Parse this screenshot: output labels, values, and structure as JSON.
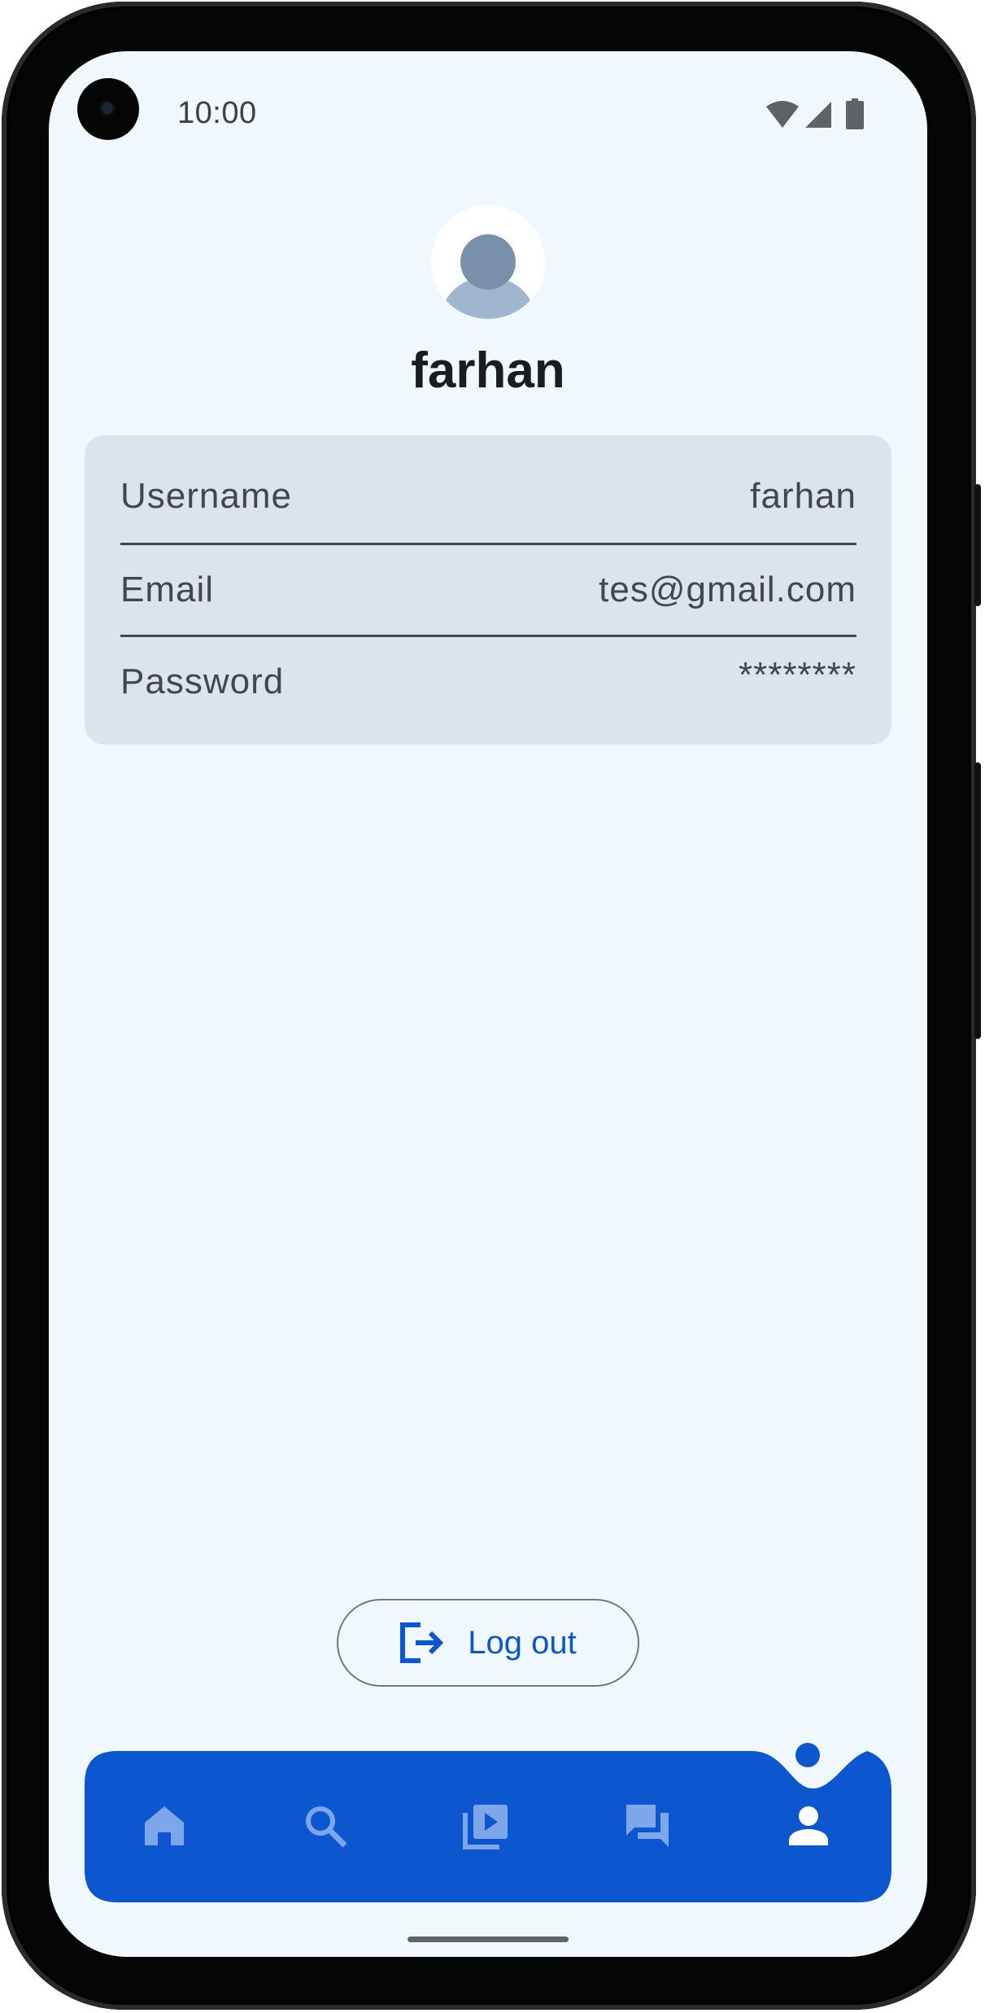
{
  "status_bar": {
    "time": "10:00",
    "icons": [
      "wifi-icon",
      "cell-signal-icon",
      "battery-icon"
    ]
  },
  "profile": {
    "name": "farhan",
    "avatar_icon": "person-avatar-icon"
  },
  "account_info": {
    "rows": [
      {
        "label": "Username",
        "value": "farhan"
      },
      {
        "label": "Email",
        "value": "tes@gmail.com"
      },
      {
        "label": "Password",
        "value": "********"
      }
    ]
  },
  "logout": {
    "label": "Log out",
    "icon": "logout-icon"
  },
  "bottom_nav": {
    "items": [
      "home-icon",
      "search-icon",
      "video-library-icon",
      "chat-icon",
      "person-icon"
    ],
    "selected": "person-icon"
  },
  "colors": {
    "accent": "#0c57d0",
    "screen_background": "#f0f8fd",
    "card_background": "#dde3ea",
    "nav_icon_inactive": "#7ea6eb",
    "nav_icon_active": "#ffffff"
  }
}
